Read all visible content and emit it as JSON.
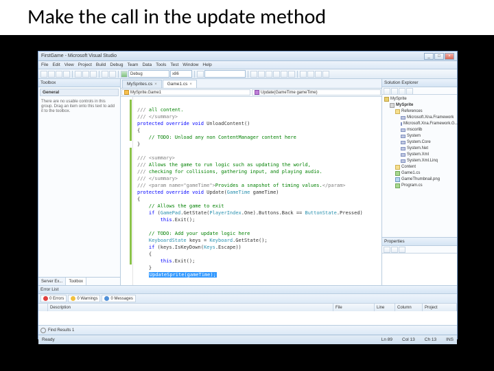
{
  "slide": {
    "title": "Make the call in the update method"
  },
  "window": {
    "title": "FirstGame - Microsoft Visual Studio",
    "min": "_",
    "max": "□",
    "close": "×"
  },
  "menu": [
    "File",
    "Edit",
    "View",
    "Project",
    "Build",
    "Debug",
    "Team",
    "Data",
    "Tools",
    "Test",
    "Window",
    "Help"
  ],
  "toolbar": {
    "config": "Debug",
    "platform": "x86"
  },
  "toolbox": {
    "title": "Toolbox",
    "group": "General",
    "empty_msg": "There are no usable controls in this group. Drag an item onto this text to add it to the toolbox.",
    "tabs": {
      "a": "Server Ex...",
      "b": "Toolbox"
    }
  },
  "tabs": {
    "file1": "MySprites.cs",
    "file2": "Game1.cs"
  },
  "codeNav": {
    "ns": "MySprite.Game1",
    "member": "Update(GameTime gameTime)"
  },
  "code": {
    "l01a": "/// ",
    "l01b": "all content.",
    "l02a": "/// ",
    "l02b": "</summary>",
    "l03a": "protected override void",
    "l03b": " UnloadContent()",
    "l04a": "{",
    "l05a": "    ",
    "l05b": "// TODO: Unload any non ContentManager content here",
    "l06a": "}",
    "l07": "",
    "l08a": "/// ",
    "l08b": "<summary>",
    "l09a": "/// ",
    "l09b": "Allows the game to run logic such as updating the world,",
    "l10a": "/// ",
    "l10b": "checking for collisions, gathering input, and playing audio.",
    "l11a": "/// ",
    "l11b": "</summary>",
    "l12a": "/// ",
    "l12b": "<param name=\"gameTime\">",
    "l12c": "Provides a snapshot of timing values.",
    "l12d": "</param>",
    "l13a": "protected override void",
    "l13b": " Update(",
    "l13c": "GameTime",
    "l13d": " gameTime)",
    "l14a": "{",
    "l15a": "    ",
    "l15b": "// Allows the game to exit",
    "l16a": "    ",
    "l16b": "if",
    "l16c": " (",
    "l16d": "GamePad",
    "l16e": ".GetState(",
    "l16f": "PlayerIndex",
    "l16g": ".One).Buttons.Back == ",
    "l16h": "ButtonState",
    "l16i": ".Pressed)",
    "l17a": "        ",
    "l17b": "this",
    "l17c": ".Exit();",
    "l18": "",
    "l19a": "    ",
    "l19b": "// TODO: Add your update logic here",
    "l20a": "    ",
    "l20b": "KeyboardState",
    "l20c": " keys = ",
    "l20d": "Keyboard",
    "l20e": ".GetState();",
    "l21a": "    ",
    "l21b": "if",
    "l21c": " (keys.IsKeyDown(",
    "l21d": "Keys",
    "l21e": ".Escape))",
    "l22a": "    {",
    "l23a": "        ",
    "l23b": "this",
    "l23c": ".Exit();",
    "l24a": "    }",
    "l25hl": "UpdateSprite(gameTime);"
  },
  "solution": {
    "title": "Solution Explorer",
    "root": "MySprite",
    "proj": "MySprite",
    "refs": "References",
    "reflist": [
      "Microsoft.Xna.Framework",
      "Microsoft.Xna.Framework.G...",
      "mscorlib",
      "System",
      "System.Core",
      "System.Net",
      "System.Xml",
      "System.Xml.Linq"
    ],
    "content": "Content",
    "file1": "Game1.cs",
    "file2": "GameThumbnail.png",
    "file3": "Program.cs"
  },
  "props": {
    "title": "Properties"
  },
  "errors": {
    "title": "Error List",
    "err": "0 Errors",
    "warn": "0 Warnings",
    "msg": "0 Messages",
    "cols": {
      "blank": "",
      "desc": "Description",
      "file": "File",
      "line": "Line",
      "col": "Column",
      "proj": "Project"
    }
  },
  "find": {
    "label": "Find Results 1"
  },
  "status": {
    "ready": "Ready",
    "ln": "Ln 89",
    "col": "Col 13",
    "ch": "Ch 13",
    "ins": "INS"
  }
}
